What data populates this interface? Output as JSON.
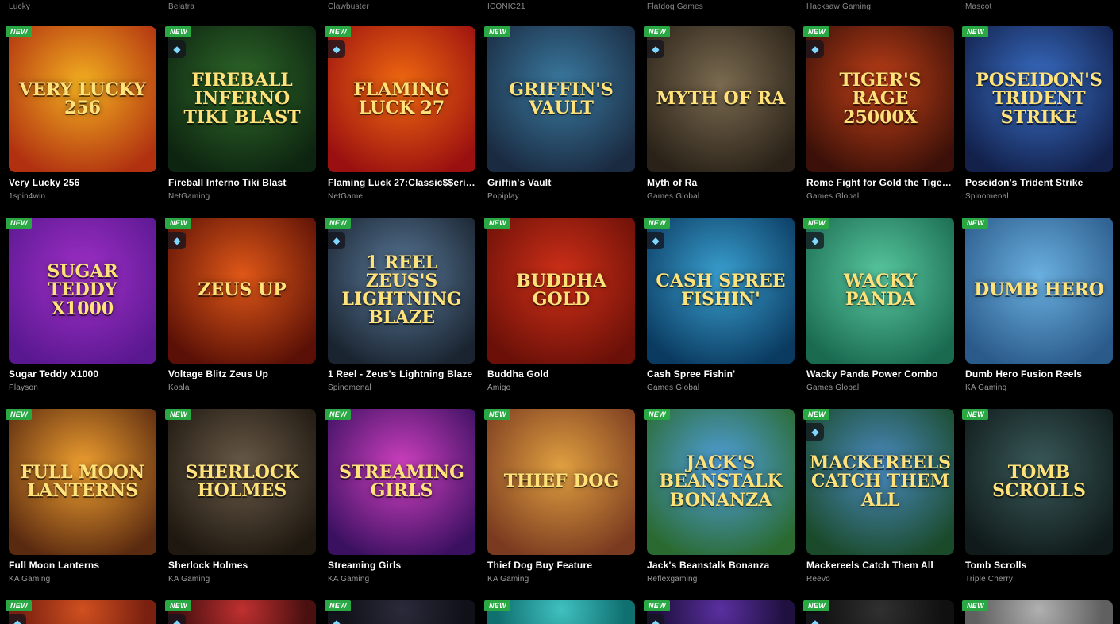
{
  "top_providers": [
    "Lucky",
    "Belatra",
    "Clawbuster",
    "ICONIC21",
    "Flatdog Games",
    "Hacksaw Gaming",
    "Mascot"
  ],
  "badge_label": "NEW",
  "diamond_icon": "diamond-icon",
  "rows": [
    [
      {
        "title": "Very Lucky 256",
        "provider": "1spin4win",
        "art": "Very Lucky 256",
        "diamond": false,
        "colors": [
          "#f3b020",
          "#b03010"
        ]
      },
      {
        "title": "Fireball Inferno Tiki Blast",
        "provider": "NetGaming",
        "art": "Fireball Inferno Tiki Blast",
        "diamond": true,
        "colors": [
          "#2f6a2a",
          "#0d2410"
        ]
      },
      {
        "title": "Flaming Luck 27:Classic$$eri…",
        "provider": "NetGame",
        "art": "Flaming Luck 27",
        "diamond": true,
        "colors": [
          "#f06a10",
          "#9a1010"
        ]
      },
      {
        "title": "Griffin's Vault",
        "provider": "Popiplay",
        "art": "Griffin's Vault",
        "diamond": false,
        "colors": [
          "#3a7aa0",
          "#1a2a40"
        ]
      },
      {
        "title": "Myth of Ra",
        "provider": "Games Global",
        "art": "Myth of Ra",
        "diamond": true,
        "colors": [
          "#7a6a50",
          "#2a2218"
        ]
      },
      {
        "title": "Rome Fight for Gold the Tige…",
        "provider": "Games Global",
        "art": "Tiger's Rage 25000X",
        "diamond": true,
        "colors": [
          "#c04018",
          "#3a1008"
        ]
      },
      {
        "title": "Poseidon's Trident Strike",
        "provider": "Spinomenal",
        "art": "Poseidon's Trident Strike",
        "diamond": false,
        "colors": [
          "#3a70c8",
          "#12204a"
        ]
      }
    ],
    [
      {
        "title": "Sugar Teddy X1000",
        "provider": "Playson",
        "art": "Sugar Teddy x1000",
        "diamond": false,
        "colors": [
          "#a030c8",
          "#5a1890"
        ]
      },
      {
        "title": "Voltage Blitz Zeus Up",
        "provider": "Koala",
        "art": "Zeus Up",
        "diamond": true,
        "colors": [
          "#e05818",
          "#5a1006"
        ]
      },
      {
        "title": "1 Reel - Zeus's Lightning Blaze",
        "provider": "Spinomenal",
        "art": "1 Reel Zeus's Lightning Blaze",
        "diamond": true,
        "colors": [
          "#5a7a9a",
          "#1a2430"
        ]
      },
      {
        "title": "Buddha Gold",
        "provider": "Amigo",
        "art": "Buddha Gold",
        "diamond": false,
        "colors": [
          "#d03018",
          "#6a1008"
        ]
      },
      {
        "title": "Cash Spree Fishin'",
        "provider": "Games Global",
        "art": "Cash Spree Fishin'",
        "diamond": true,
        "colors": [
          "#3aa0d0",
          "#0a3a60"
        ]
      },
      {
        "title": "Wacky Panda Power Combo",
        "provider": "Games Global",
        "art": "Wacky Panda",
        "diamond": true,
        "colors": [
          "#58c8a0",
          "#1a6a50"
        ]
      },
      {
        "title": "Dumb Hero Fusion Reels",
        "provider": "KA Gaming",
        "art": "Dumb Hero",
        "diamond": false,
        "colors": [
          "#6ab0e0",
          "#2a5a8a"
        ]
      }
    ],
    [
      {
        "title": "Full Moon Lanterns",
        "provider": "KA Gaming",
        "art": "Full Moon Lanterns",
        "diamond": false,
        "colors": [
          "#f0a030",
          "#5a2a10"
        ]
      },
      {
        "title": "Sherlock Holmes",
        "provider": "KA Gaming",
        "art": "Sherlock Holmes",
        "diamond": false,
        "colors": [
          "#6a5a48",
          "#1e1810"
        ]
      },
      {
        "title": "Streaming Girls",
        "provider": "KA Gaming",
        "art": "Streaming Girls",
        "diamond": false,
        "colors": [
          "#d040c0",
          "#3a1060"
        ]
      },
      {
        "title": "Thief Dog Buy Feature",
        "provider": "KA Gaming",
        "art": "Thief Dog",
        "diamond": false,
        "colors": [
          "#e0a040",
          "#7a3a20"
        ]
      },
      {
        "title": "Jack's Beanstalk Bonanza",
        "provider": "Reflexgaming",
        "art": "Jack's Beanstalk Bonanza",
        "diamond": false,
        "colors": [
          "#50a0e0",
          "#2a6a30"
        ]
      },
      {
        "title": "Mackereels Catch Them All",
        "provider": "Reevo",
        "art": "Mackereels Catch Them All",
        "diamond": true,
        "colors": [
          "#4a8ac0",
          "#1a4a2a"
        ]
      },
      {
        "title": "Tomb Scrolls",
        "provider": "Triple Cherry",
        "art": "Tomb Scrolls",
        "diamond": false,
        "colors": [
          "#3a5a5a",
          "#101a1a"
        ]
      }
    ],
    [
      {
        "diamond": true,
        "colors": [
          "#d05020",
          "#7a2010"
        ]
      },
      {
        "diamond": true,
        "colors": [
          "#c03030",
          "#4a1010"
        ]
      },
      {
        "diamond": true,
        "colors": [
          "#2a2a3a",
          "#101018"
        ]
      },
      {
        "diamond": false,
        "colors": [
          "#40c0c0",
          "#107070"
        ]
      },
      {
        "diamond": true,
        "colors": [
          "#5a30a0",
          "#201040"
        ]
      },
      {
        "diamond": true,
        "colors": [
          "#303030",
          "#101010"
        ]
      },
      {
        "diamond": false,
        "colors": [
          "#b0b0b0",
          "#606060"
        ]
      }
    ]
  ]
}
